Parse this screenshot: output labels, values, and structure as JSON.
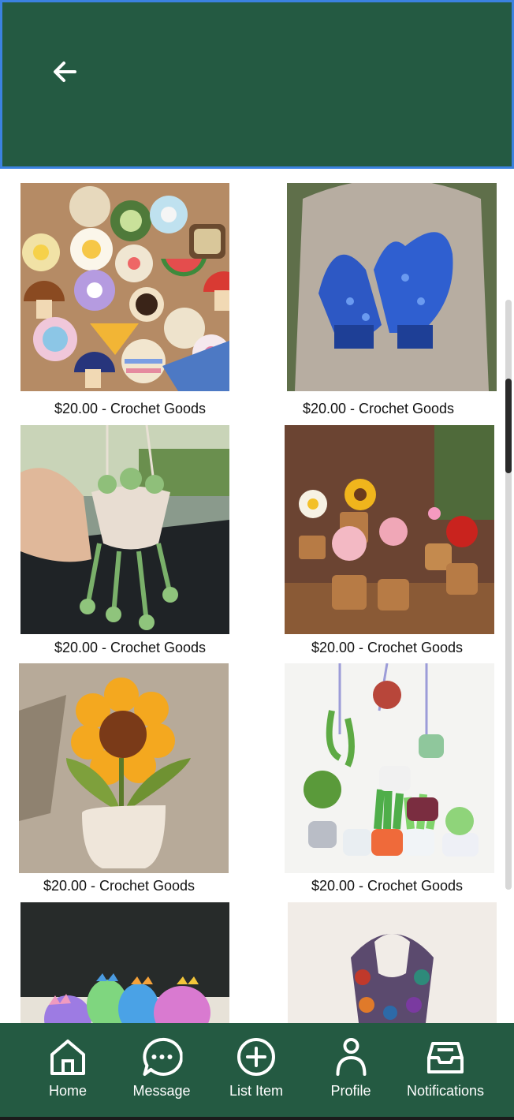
{
  "header": {
    "back_icon": "arrow-left-icon",
    "color": "#245a42"
  },
  "listings": [
    {
      "caption": "$20.00 - Crochet Goods",
      "image": "coasters-photo"
    },
    {
      "caption": "$20.00 - Crochet Goods",
      "image": "blue-mittens-photo"
    },
    {
      "caption": "$20.00 - Crochet Goods",
      "image": "hanging-plant-photo"
    },
    {
      "caption": "$20.00 - Crochet Goods",
      "image": "potted-flowers-photo"
    },
    {
      "caption": "$20.00 - Crochet Goods",
      "image": "sunflower-pot-photo"
    },
    {
      "caption": "$20.00 - Crochet Goods",
      "image": "mini-plants-photo"
    },
    {
      "caption": "",
      "image": "dinosaurs-photo"
    },
    {
      "caption": "",
      "image": "scarf-photo"
    }
  ],
  "bottom_nav": {
    "items": [
      {
        "label": "Home",
        "icon": "home-icon"
      },
      {
        "label": "Message",
        "icon": "chat-bubble-icon"
      },
      {
        "label": "List Item",
        "icon": "plus-circle-icon"
      },
      {
        "label": "Profile",
        "icon": "person-icon"
      },
      {
        "label": "Notifications",
        "icon": "inbox-icon"
      }
    ]
  }
}
